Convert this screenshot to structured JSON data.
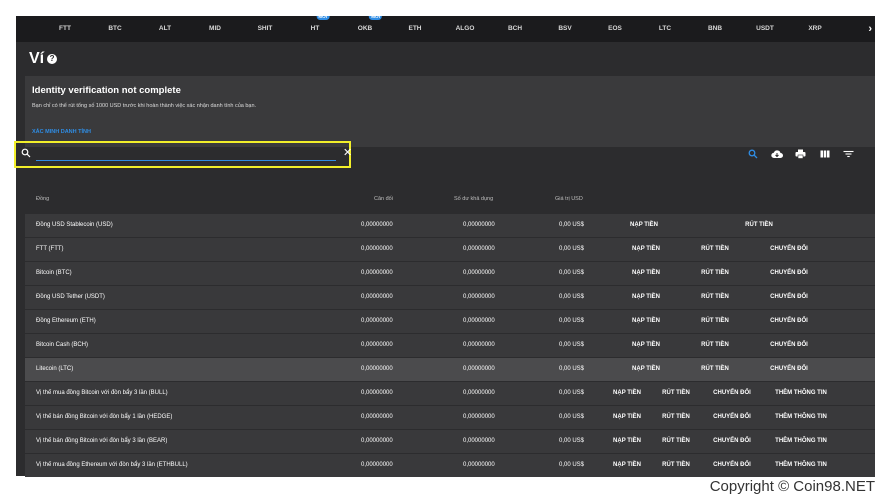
{
  "topnav": {
    "items": [
      {
        "label": "FTT",
        "badge": ""
      },
      {
        "label": "BTC",
        "badge": ""
      },
      {
        "label": "ALT",
        "badge": ""
      },
      {
        "label": "MID",
        "badge": ""
      },
      {
        "label": "SHIT",
        "badge": ""
      },
      {
        "label": "HT",
        "badge": "MỚI"
      },
      {
        "label": "OKB",
        "badge": "MỚI"
      },
      {
        "label": "ETH",
        "badge": ""
      },
      {
        "label": "ALGO",
        "badge": ""
      },
      {
        "label": "BCH",
        "badge": ""
      },
      {
        "label": "BSV",
        "badge": ""
      },
      {
        "label": "EOS",
        "badge": ""
      },
      {
        "label": "LTC",
        "badge": ""
      },
      {
        "label": "BNB",
        "badge": ""
      },
      {
        "label": "USDT",
        "badge": ""
      },
      {
        "label": "XRP",
        "badge": ""
      }
    ],
    "next_label": "›"
  },
  "page": {
    "title": "Ví",
    "help": "?"
  },
  "verification": {
    "title": "Identity verification not complete",
    "text": "Bạn chỉ có thể rút tổng số 1000 USD trước khi hoàn thành việc xác nhận danh tính của bạn.",
    "link": "XÁC MINH DANH TÍNH"
  },
  "search": {
    "value": "",
    "placeholder": "",
    "clear": "✕"
  },
  "table": {
    "headers": {
      "coin": "Đồng",
      "balance": "Cân đối",
      "available": "Số dư khả dụng",
      "value": "Giá trị USD"
    },
    "rows": [
      {
        "coin": "Đồng USD Stablecoin (USD)",
        "balance": "0,00000000",
        "available": "0,00000000",
        "value": "0,00 US$",
        "actions": [
          "NẠP TIỀN",
          "RÚT TIỀN"
        ]
      },
      {
        "coin": "FTT (FTT)",
        "balance": "0,00000000",
        "available": "0,00000000",
        "value": "0,00 US$",
        "actions": [
          "NẠP TIỀN",
          "RÚT TIỀN",
          "CHUYỂN ĐỔI"
        ]
      },
      {
        "coin": "Bitcoin (BTC)",
        "balance": "0,00000000",
        "available": "0,00000000",
        "value": "0,00 US$",
        "actions": [
          "NẠP TIỀN",
          "RÚT TIỀN",
          "CHUYỂN ĐỔI"
        ]
      },
      {
        "coin": "Đồng USD Tether (USDT)",
        "balance": "0,00000000",
        "available": "0,00000000",
        "value": "0,00 US$",
        "actions": [
          "NẠP TIỀN",
          "RÚT TIỀN",
          "CHUYỂN ĐỔI"
        ]
      },
      {
        "coin": "Đồng Ethereum (ETH)",
        "balance": "0,00000000",
        "available": "0,00000000",
        "value": "0,00 US$",
        "actions": [
          "NẠP TIỀN",
          "RÚT TIỀN",
          "CHUYỂN ĐỔI"
        ]
      },
      {
        "coin": "Bitcoin Cash (BCH)",
        "balance": "0,00000000",
        "available": "0,00000000",
        "value": "0,00 US$",
        "actions": [
          "NẠP TIỀN",
          "RÚT TIỀN",
          "CHUYỂN ĐỔI"
        ]
      },
      {
        "coin": "Litecoin (LTC)",
        "balance": "0,00000000",
        "available": "0,00000000",
        "value": "0,00 US$",
        "actions": [
          "NẠP TIỀN",
          "RÚT TIỀN",
          "CHUYỂN ĐỔI"
        ]
      },
      {
        "coin": "Vị thế mua đồng Bitcoin với đòn bẩy 3 lần (BULL)",
        "balance": "0,00000000",
        "available": "0,00000000",
        "value": "0,00 US$",
        "actions": [
          "NẠP TIỀN",
          "RÚT TIỀN",
          "CHUYỂN ĐỔI",
          "THÊM THÔNG TIN"
        ]
      },
      {
        "coin": "Vị thế bán đồng Bitcoin với đòn bẩy 1 lần (HEDGE)",
        "balance": "0,00000000",
        "available": "0,00000000",
        "value": "0,00 US$",
        "actions": [
          "NẠP TIỀN",
          "RÚT TIỀN",
          "CHUYỂN ĐỔI",
          "THÊM THÔNG TIN"
        ]
      },
      {
        "coin": "Vị thế bán đồng Bitcoin với đòn bẩy 3 lần (BEAR)",
        "balance": "0,00000000",
        "available": "0,00000000",
        "value": "0,00 US$",
        "actions": [
          "NẠP TIỀN",
          "RÚT TIỀN",
          "CHUYỂN ĐỔI",
          "THÊM THÔNG TIN"
        ]
      },
      {
        "coin": "Vị thế mua đồng Ethereum với đòn bẩy 3 lần (ETHBULL)",
        "balance": "0,00000000",
        "available": "0,00000000",
        "value": "0,00 US$",
        "actions": [
          "NẠP TIỀN",
          "RÚT TIỀN",
          "CHUYỂN ĐỔI",
          "THÊM THÔNG TIN"
        ]
      }
    ],
    "selected_row": "Litecoin (LTC)"
  },
  "colors": {
    "accent": "#2f8de4",
    "highlight": "#f2ef2a",
    "background": "#2c2c2e",
    "topbar": "#1b1b1d"
  },
  "icons": {
    "search": "search-icon",
    "download": "cloud-download-icon",
    "print": "print-icon",
    "columns": "columns-icon",
    "filter": "filter-icon",
    "help": "help-icon"
  },
  "copyright": "Copyright © Coin98.NET"
}
